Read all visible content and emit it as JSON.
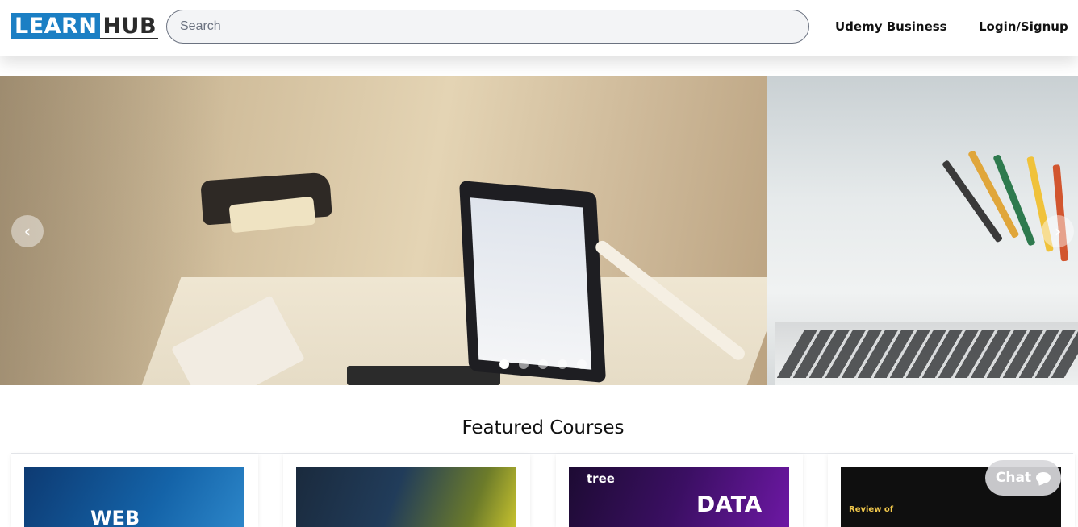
{
  "header": {
    "logo": {
      "part1": "LEARN",
      "part2": "HUB"
    },
    "search": {
      "placeholder": "Search",
      "value": ""
    },
    "nav": {
      "business": "Udemy Business",
      "login": "Login/Signup"
    }
  },
  "carousel": {
    "prev_icon": "chevron-left-icon",
    "next_icon": "chevron-right-icon",
    "prev_glyph": "‹",
    "next_glyph": "›",
    "slide_count": 5,
    "active_slide": 1
  },
  "featured": {
    "title": "Featured Courses",
    "cards": [
      {
        "image_text": "WEB"
      },
      {
        "image_text": ""
      },
      {
        "image_text": "DATA",
        "logo_text": "tree"
      },
      {
        "image_text": "Review of"
      }
    ]
  },
  "chat": {
    "label": "Chat",
    "icon": "chat-bubble-icon"
  },
  "colors": {
    "brand": "#1b7fc4",
    "text": "#111111"
  }
}
